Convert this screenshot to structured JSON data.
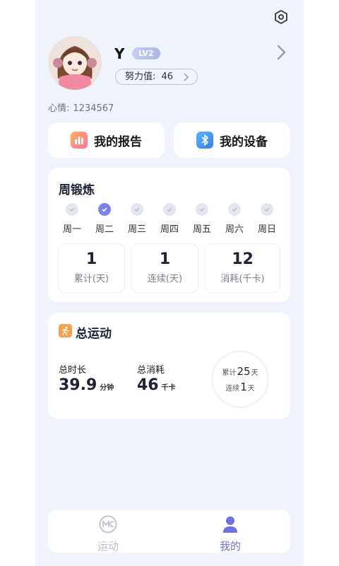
{
  "header": {
    "settings_icon": "hexagon-gear-icon"
  },
  "profile": {
    "name": "Y",
    "level": "LV2",
    "effort_label": "努力值:",
    "effort_value": "46",
    "mood_label": "心情:",
    "mood_value": "1234567"
  },
  "quick_actions": [
    {
      "label": "我的报告",
      "icon": "report-chart-icon"
    },
    {
      "label": "我的设备",
      "icon": "bluetooth-icon"
    }
  ],
  "weekly": {
    "title": "周锻炼",
    "days": [
      {
        "label": "周一",
        "checked": false
      },
      {
        "label": "周二",
        "checked": true
      },
      {
        "label": "周三",
        "checked": false
      },
      {
        "label": "周四",
        "checked": false
      },
      {
        "label": "周五",
        "checked": false
      },
      {
        "label": "周六",
        "checked": false
      },
      {
        "label": "周日",
        "checked": false
      }
    ],
    "stats": [
      {
        "value": "1",
        "label": "累计(天)"
      },
      {
        "value": "1",
        "label": "连续(天)"
      },
      {
        "value": "12",
        "label": "消耗(千卡)"
      }
    ]
  },
  "total": {
    "title": "总运动",
    "duration_label": "总时长",
    "duration_value": "39.9",
    "duration_unit": "分钟",
    "calorie_label": "总消耗",
    "calorie_value": "46",
    "calorie_unit": "千卡",
    "ring_cumulative_label": "累计",
    "ring_cumulative_value": "25",
    "ring_cumulative_unit": "天",
    "ring_streak_label": "连续",
    "ring_streak_value": "1",
    "ring_streak_unit": "天"
  },
  "tabbar": [
    {
      "label": "运动",
      "active": false
    },
    {
      "label": "我的",
      "active": true
    }
  ],
  "colors": {
    "accent": "#6f6fe8",
    "inactive": "#b8bcc6",
    "background": "#eff3fb"
  }
}
